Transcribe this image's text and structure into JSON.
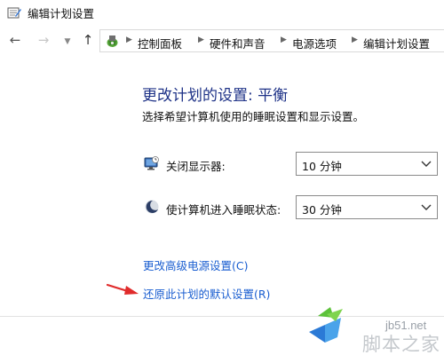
{
  "window": {
    "title": "编辑计划设置"
  },
  "nav": {
    "back_icon": "arrow-left-icon",
    "forward_icon": "arrow-right-icon",
    "recent_icon": "chevron-down-icon",
    "up_icon": "arrow-up-icon",
    "breadcrumbs": [
      "控制面板",
      "硬件和声音",
      "电源选项",
      "编辑计划设置"
    ]
  },
  "main": {
    "title": "更改计划的设置: 平衡",
    "subtitle": "选择希望计算机使用的睡眠设置和显示设置。",
    "settings": [
      {
        "label": "关闭显示器:",
        "value": "10 分钟",
        "icon": "monitor-icon"
      },
      {
        "label": "使计算机进入睡眠状态:",
        "value": "30 分钟",
        "icon": "moon-icon"
      }
    ],
    "links": {
      "advanced": "更改高级电源设置(C)",
      "restore": "还原此计划的默认设置(R)"
    }
  },
  "watermark": {
    "domain": "jb51.net",
    "name": "脚本之家"
  },
  "colors": {
    "title_blue": "#1e3287",
    "link_blue": "#1a5ed0",
    "annotation_red": "#e02b2b"
  }
}
